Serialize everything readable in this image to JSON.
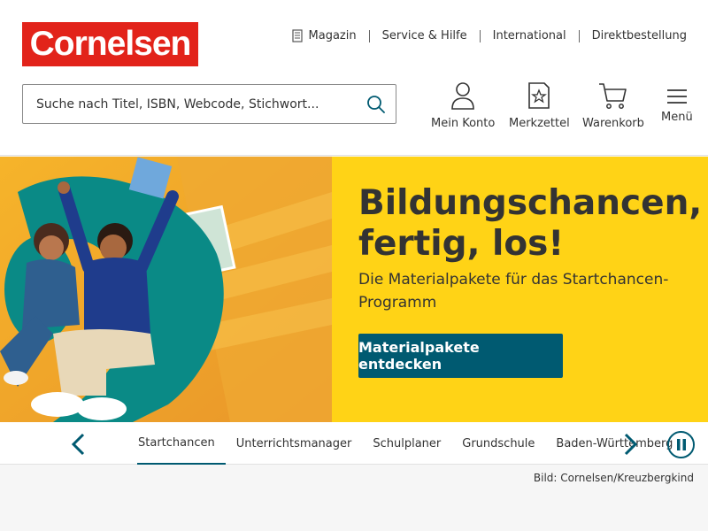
{
  "header": {
    "logo": "Cornelsen",
    "topnav": [
      "Magazin",
      "Service & Hilfe",
      "International",
      "Direktbestellung"
    ],
    "search_placeholder": "Suche nach Titel, ISBN, Webcode, Stichwort...",
    "icons": [
      {
        "label": "Mein Konto",
        "icon": "user-icon"
      },
      {
        "label": "Merkzettel",
        "icon": "bookmark-star-icon"
      },
      {
        "label": "Warenkorb",
        "icon": "cart-icon"
      },
      {
        "label": "Menü",
        "icon": "hamburger-icon"
      }
    ]
  },
  "hero": {
    "title_line1": "Bildungschancen,",
    "title_line2": "fertig, los!",
    "subtitle": "Die Materialpakete für das Startchancen-Programm",
    "cta": "Materialpakete entdecken",
    "background_color": "#ffd316",
    "cta_color": "#005a71"
  },
  "carousel": {
    "tabs": [
      "Startchancen",
      "Unterrichtsmanager",
      "Schulplaner",
      "Grundschule",
      "Baden-Württemberg"
    ],
    "active_tab": "Startchancen"
  },
  "credit": "Bild: Cornelsen/Kreuzbergkind",
  "colors": {
    "brand_red": "#e2231a",
    "accent_teal": "#005a71"
  }
}
